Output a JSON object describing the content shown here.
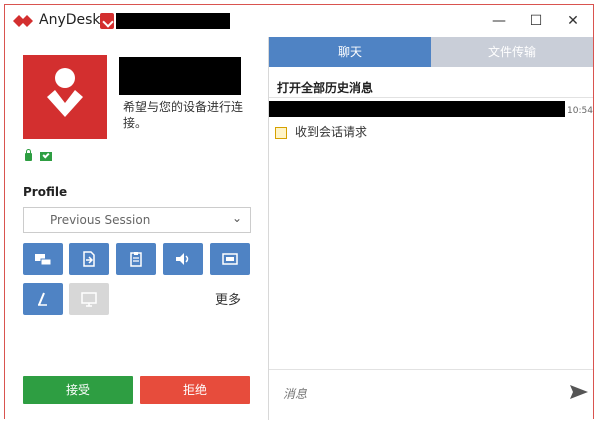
{
  "window": {
    "app_title": "AnyDesk",
    "controls": {
      "minimize": "—",
      "maximize": "☐",
      "close": "✕"
    }
  },
  "left": {
    "status_text": "希望与您的设备进行连接。",
    "profile": {
      "label": "Profile",
      "selected": "Previous Session"
    },
    "tools": [
      {
        "name": "keyboard-icon"
      },
      {
        "name": "file-transfer-icon"
      },
      {
        "name": "clipboard-icon"
      },
      {
        "name": "audio-icon"
      },
      {
        "name": "screen-icon"
      },
      {
        "name": "draw-icon"
      },
      {
        "name": "display-disabled-icon"
      }
    ],
    "more_label": "更多",
    "accept_label": "接受",
    "reject_label": "拒绝"
  },
  "right": {
    "tabs": [
      "聊天",
      "文件传输"
    ],
    "history_label": "打开全部历史消息",
    "message_time": "10:54",
    "event_text": "收到会话请求",
    "input_placeholder": "消息"
  },
  "colors": {
    "brand_red": "#d32f2f",
    "accent_blue": "#4f83c4",
    "accept_green": "#2e9e42",
    "reject_red": "#e74c3c"
  }
}
